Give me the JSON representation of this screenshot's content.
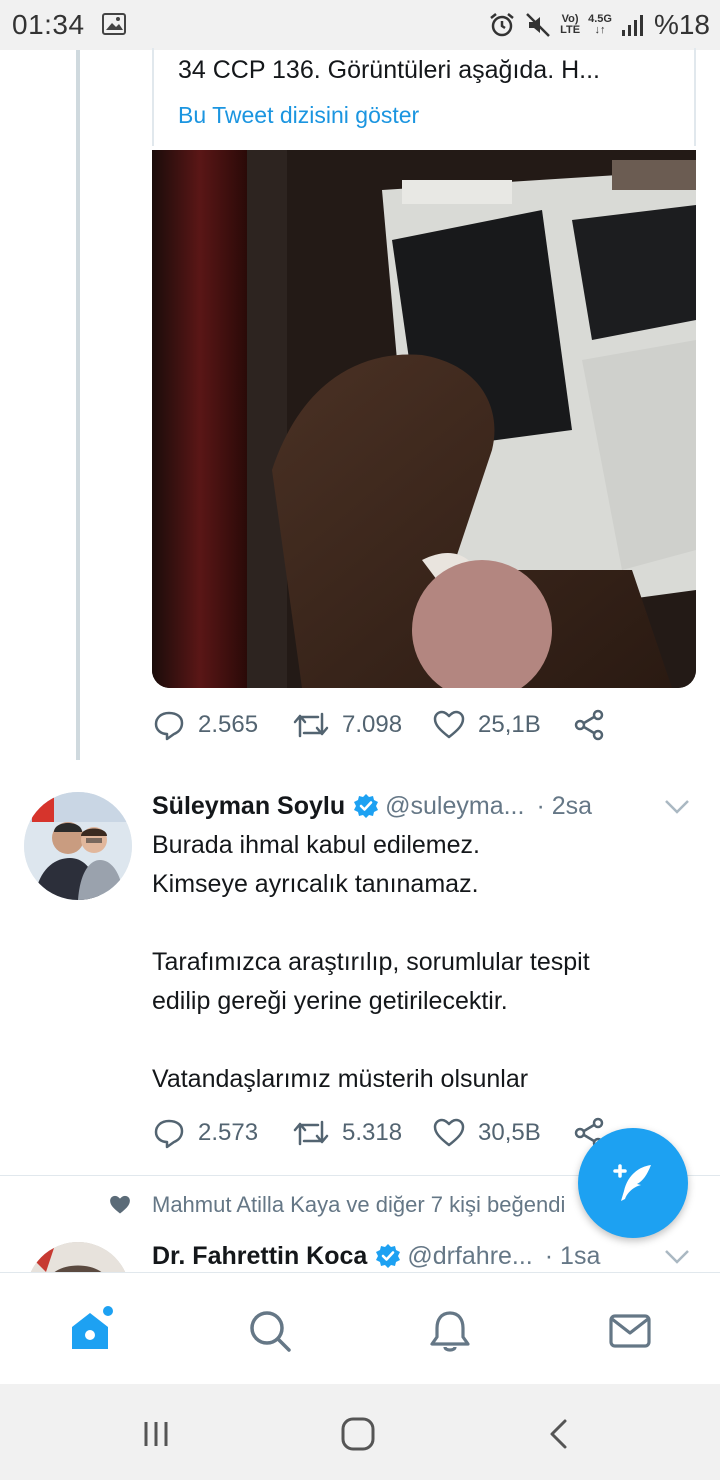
{
  "status_bar": {
    "time": "01:34",
    "volte": "Vo)",
    "lte": "LTE",
    "net": "4.5G",
    "battery": "%18"
  },
  "quoted_tweet": {
    "text": "34 CCP 136. Görüntüleri aşağıda. H...",
    "show_thread_link": "Bu Tweet dizisini göster"
  },
  "first_tweet": {
    "replies": "2.565",
    "retweets": "7.098",
    "likes": "25,1B"
  },
  "tweet": {
    "name": "Süleyman Soylu",
    "handle": "@suleyma...",
    "time": "· 2sa",
    "body": [
      "Burada ihmal kabul edilemez.",
      "Kimseye ayrıcalık tanınamaz.",
      "",
      "Tarafımızca araştırılıp, sorumlular tespit",
      "edilip gereği yerine getirilecektir.",
      "",
      "Vatandaşlarımız müsterih olsunlar"
    ],
    "replies": "2.573",
    "retweets": "5.318",
    "likes": "30,5B"
  },
  "liked_by": "Mahmut Atilla Kaya ve diğer 7 kişi beğendi",
  "next_tweet": {
    "name": "Dr. Fahrettin Koca",
    "handle": "@drfahre...",
    "time": "· 1sa"
  },
  "colors": {
    "accent": "#1da1f2",
    "link": "#1b95e0",
    "muted": "#657786"
  }
}
